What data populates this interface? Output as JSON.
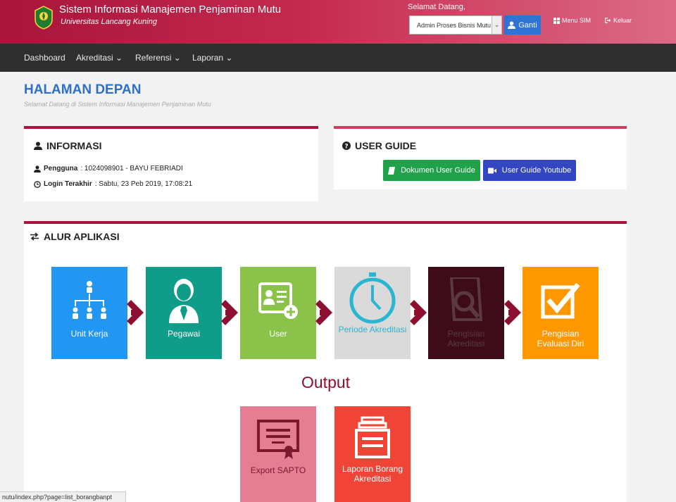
{
  "header": {
    "title": "Sistem Informasi Manajemen Penjaminan Mutu",
    "subtitle": "Universitas Lancang Kuning",
    "welcome": "Selamat Datang,",
    "role_select_value": "Admin Proses Bisnis Mutu - U",
    "ganti_label": "Ganti",
    "menu_sim_label": "Menu SIM",
    "keluar_label": "Keluar"
  },
  "nav": {
    "dashboard": "Dashboard",
    "akreditasi": "Akreditasi",
    "referensi": "Referensi",
    "laporan": "Laporan"
  },
  "page": {
    "title": "HALAMAN DEPAN",
    "subtitle": "Selamat Datang di Sistem Informasi Manajemen Penjaminan Mutu"
  },
  "informasi": {
    "heading": "INFORMASI",
    "pengguna_label": "Pengguna",
    "pengguna_value": ": 1024098901 - BAYU FEBRIADI",
    "login_label": "Login Terakhir",
    "login_value": ": Sabtu, 23 Peb 2019, 17:08:21"
  },
  "user_guide": {
    "heading": "USER GUIDE",
    "doc_label": "Dokumen User Guide",
    "yt_label": "User Guide Youtube"
  },
  "alur": {
    "heading": "ALUR APLIKASI",
    "tiles": [
      {
        "label": "Unit Kerja",
        "color": "#2196f3"
      },
      {
        "label": "Pegawai",
        "color": "#0f9c88"
      },
      {
        "label": "User",
        "color": "#8bc34a"
      },
      {
        "label": "Periode Akreditasi",
        "color": "#dadada"
      },
      {
        "label": "Pengisian Akreditasi",
        "color": "#3e0c18"
      },
      {
        "label": "Pengisian Evaluasi Diri",
        "color": "#ff9800"
      }
    ],
    "output_heading": "Output",
    "outputs": [
      {
        "label": "Export SAPTO",
        "color": "#e57d93"
      },
      {
        "label": "Laporan Borang Akreditasi",
        "color": "#f04437"
      }
    ]
  },
  "status_bar": "nutu/index.php?page=list_borangbanpt",
  "colors": {
    "brand": "#a8143c",
    "arrow": "#8e1030",
    "accent_blue": "#2f6fc9"
  }
}
